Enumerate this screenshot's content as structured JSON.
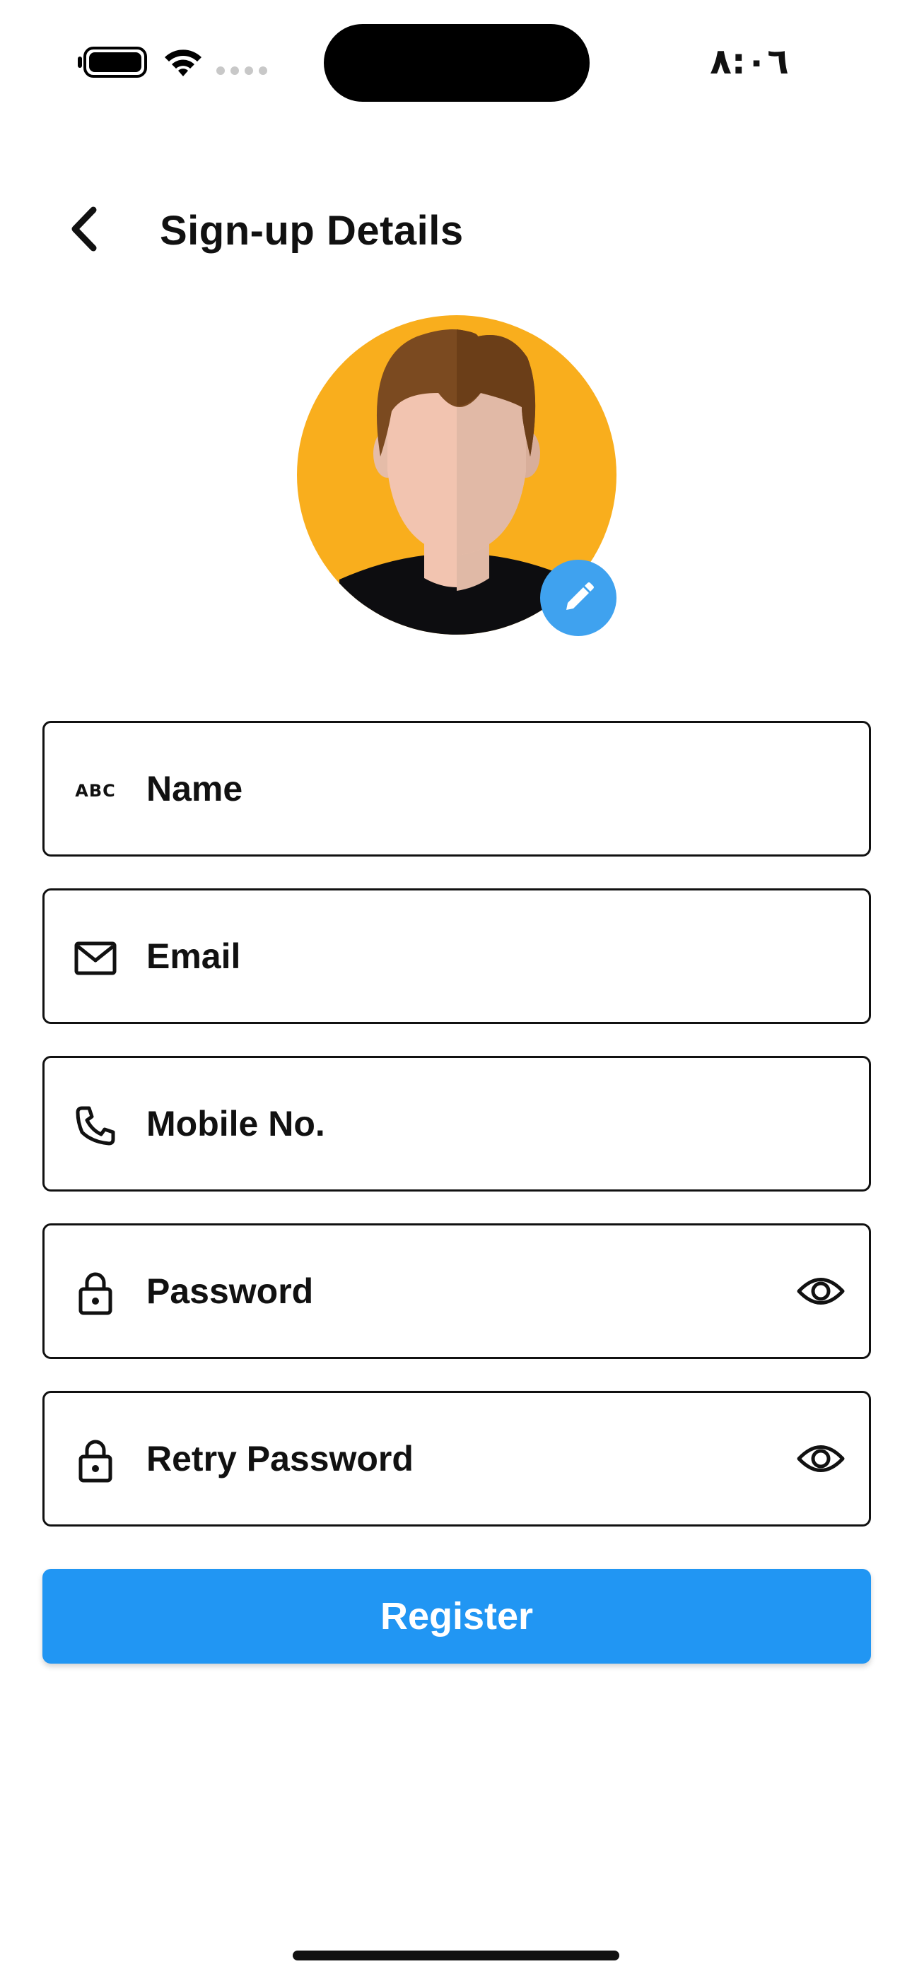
{
  "status_bar": {
    "time": "٨:٠٦",
    "battery_icon": "battery-icon",
    "wifi_icon": "wifi-icon",
    "cellular_icon": "cellular-dots-icon"
  },
  "header": {
    "back_icon": "chevron-left-icon",
    "title": "Sign-up Details"
  },
  "avatar": {
    "image": "male-avatar",
    "edit_icon": "pencil-icon",
    "badge_color": "#3fa2ef",
    "background_color": "#f9ae1d"
  },
  "form": {
    "fields": [
      {
        "icon": "abc-icon",
        "icon_text": "ABC",
        "placeholder": "Name",
        "value": ""
      },
      {
        "icon": "mail-icon",
        "placeholder": "Email",
        "value": ""
      },
      {
        "icon": "phone-icon",
        "placeholder": "Mobile No.",
        "value": ""
      },
      {
        "icon": "lock-icon",
        "placeholder": "Password",
        "value": "",
        "trailing_icon": "eye-icon"
      },
      {
        "icon": "lock-icon",
        "placeholder": "Retry Password",
        "value": "",
        "trailing_icon": "eye-icon"
      }
    ],
    "submit_label": "Register",
    "submit_color": "#2196f3"
  }
}
